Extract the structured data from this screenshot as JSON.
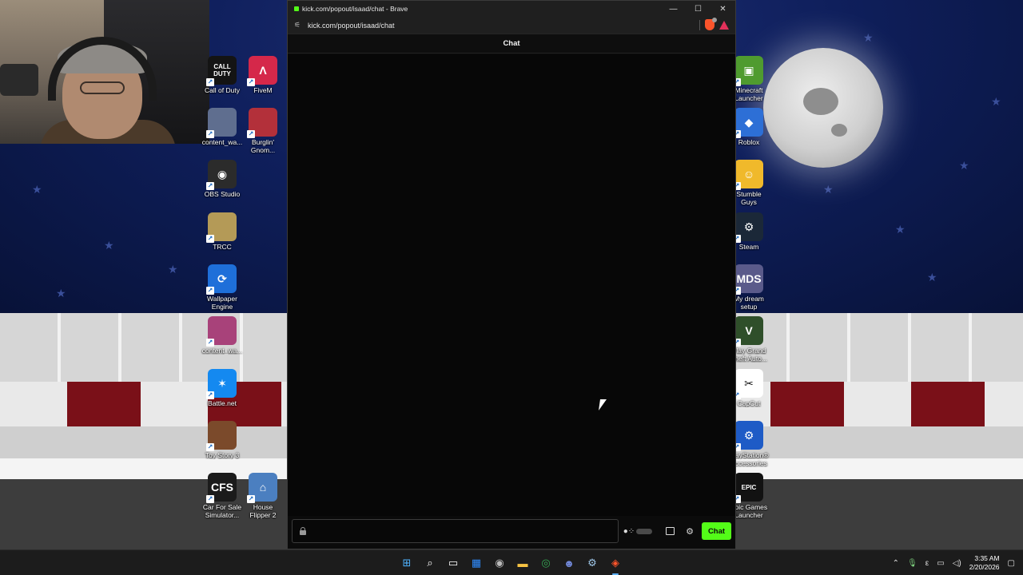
{
  "browser": {
    "window_title": "kick.com/popout/isaad/chat - Brave",
    "url": "kick.com/popout/isaad/chat",
    "controls": {
      "minimize": "—",
      "maximize": "☐",
      "close": "✕"
    },
    "header_title": "Chat",
    "send_label": "Chat"
  },
  "desktop": {
    "left_icons": [
      {
        "line1": "Call of Duty",
        "line2": "",
        "glyph": "CALL\nDUTY",
        "color": "#141414"
      },
      {
        "line1": "FiveM",
        "line2": "",
        "glyph": "Λ",
        "color": "#d5284a"
      },
      {
        "line1": "content_wa...",
        "line2": "",
        "glyph": "",
        "color": "#5f6e8f"
      },
      {
        "line1": "Burglin'",
        "line2": "Gnom...",
        "glyph": "",
        "color": "#b3303a"
      },
      {
        "line1": "OBS Studio",
        "line2": "",
        "glyph": "◉",
        "color": "#2b2b2b"
      },
      {
        "line1": "TRCC",
        "line2": "",
        "glyph": "",
        "color": "#b49a57"
      },
      {
        "line1": "Wallpaper",
        "line2": "Engine",
        "glyph": "⟳",
        "color": "#1e6fd9"
      },
      {
        "line1": "content_wa...",
        "line2": "",
        "glyph": "",
        "color": "#a8427a"
      },
      {
        "line1": "Battle.net",
        "line2": "",
        "glyph": "✶",
        "color": "#1489f0"
      },
      {
        "line1": "Toy Story 3",
        "line2": "",
        "glyph": "",
        "color": "#7b4a2b"
      },
      {
        "line1": "Car For Sale",
        "line2": "Simulator...",
        "glyph": "CFS",
        "color": "#1b1b1b"
      },
      {
        "line1": "House",
        "line2": "Flipper 2",
        "glyph": "⌂",
        "color": "#4b7fc0"
      }
    ],
    "right_icons": [
      {
        "line1": "Minecraft",
        "line2": "Launcher",
        "glyph": "▣",
        "color": "#4f9b2f"
      },
      {
        "line1": "Roblox",
        "line2": "",
        "glyph": "◆",
        "color": "#2d6fd6"
      },
      {
        "line1": "Stumble",
        "line2": "Guys",
        "glyph": "☺",
        "color": "#f0b92b"
      },
      {
        "line1": "Steam",
        "line2": "",
        "glyph": "⚙",
        "color": "#1b2838"
      },
      {
        "line1": "My dream",
        "line2": "setup",
        "glyph": "MDS",
        "color": "#5a5a8a"
      },
      {
        "line1": "Play Grand",
        "line2": "Theft Auto...",
        "glyph": "V",
        "color": "#2f4f2a"
      },
      {
        "line1": "CapCut",
        "line2": "",
        "glyph": "✂",
        "color": "#ffffff"
      },
      {
        "line1": "PlayStation®",
        "line2": "Accessories",
        "glyph": "⚙",
        "color": "#1e5bc6"
      },
      {
        "line1": "Epic Games",
        "line2": "Launcher",
        "glyph": "EPIC",
        "color": "#121212"
      }
    ]
  },
  "taskbar": {
    "apps": [
      {
        "name": "start",
        "glyph": "⊞",
        "color": "#4fb3ff"
      },
      {
        "name": "search",
        "glyph": "⌕",
        "color": "#ffffff"
      },
      {
        "name": "task-view",
        "glyph": "▭",
        "color": "#ffffff"
      },
      {
        "name": "microsoft-store",
        "glyph": "▦",
        "color": "#2f8cff"
      },
      {
        "name": "obs",
        "glyph": "◉",
        "color": "#bbbbbb"
      },
      {
        "name": "file-explorer",
        "glyph": "▬",
        "color": "#f6c343"
      },
      {
        "name": "chrome",
        "glyph": "◎",
        "color": "#34a853"
      },
      {
        "name": "discord",
        "glyph": "☻",
        "color": "#7289da"
      },
      {
        "name": "steam",
        "glyph": "⚙",
        "color": "#9fc7e8"
      },
      {
        "name": "brave",
        "glyph": "◈",
        "color": "#fb542b"
      }
    ],
    "time": "3:35 AM",
    "date": "2/20/2026",
    "lang": "ε"
  }
}
